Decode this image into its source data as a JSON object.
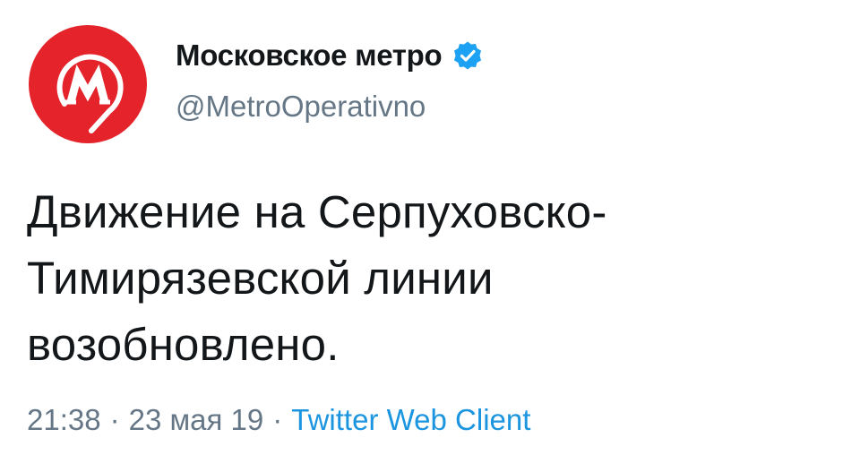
{
  "author": {
    "display_name": "Московское метро",
    "handle": "@MetroOperativno",
    "verified": true,
    "avatar_icon": "moscow-metro-logo-icon",
    "avatar_color": "#e5232b"
  },
  "tweet": {
    "text_lines": [
      "Движение на Серпуховско-",
      "Тимирязевской линии",
      "возобновлено."
    ],
    "time": "21:38",
    "date": "23 мая 19",
    "separator": "·",
    "client": "Twitter Web Client"
  },
  "colors": {
    "text": "#14171a",
    "secondary": "#657786",
    "link": "#1b95e0",
    "verified_badge": "#1da1f2"
  }
}
